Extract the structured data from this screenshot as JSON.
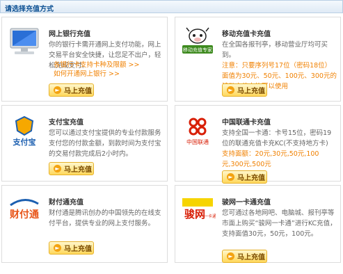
{
  "header": {
    "title": "请选择充值方式"
  },
  "cards": [
    {
      "title": "网上银行充值",
      "desc": "你的银行卡需开通网上支付功能，网上交易平台安全快捷，让您足不出户，轻松完成支付。",
      "links": [
        "各银行卡支持卡种及限额 >>",
        "如何开通网上银行 >>"
      ],
      "button": "马上充值"
    },
    {
      "title": "移动充值卡充值",
      "desc": "在全国各报刊亭，移动营业厅均可买到。",
      "note": "注意：只要序列号17位（密码18位）面值为30元、50元、100元、300元的移动充值卡均可以使用",
      "button": "马上充值"
    },
    {
      "title": "支付宝充值",
      "desc": "您可以通过支付宝提供的专业付款服务支付您的付款金额，到款时间为支付宝的交易付款完成后2小时内。",
      "button": "马上充值"
    },
    {
      "title": "中国联通卡充值",
      "desc": "支持全国一卡通：卡号15位，密码19位的联通充值卡充KC(不支持地方卡)",
      "note": "支持面额：20元,30元,50元,100元,300元,500元",
      "button": "马上充值"
    },
    {
      "title": "财付通充值",
      "desc": "财付通是腾讯创办的中国领先的在线支付平台，提供专业的网上支付服务。",
      "button": "马上充值"
    },
    {
      "title": "骏网一卡通充值",
      "desc": "您可通过各地网吧、电脑城、报刊亭等市面上购买“骏网一卡通”进行KC充值，支持面值30元，50元，100元。",
      "button": "马上充值"
    }
  ],
  "logos": {
    "zhifubao": "支付宝",
    "unicom": "中国联通",
    "tenpay": "财付通",
    "junnet": "骏网",
    "junnet_small": "一卡通",
    "mobile": "移动充值专家"
  },
  "colors": {
    "accent": "#f08000",
    "header_text": "#0b4f92",
    "button_bg": "#ffd85c"
  },
  "icons": [
    "computer-icon",
    "cow-mascot-icon",
    "alipay-logo-icon",
    "china-unicom-logo-icon",
    "tenpay-logo-icon",
    "junnet-logo-icon",
    "arrow-right-icon"
  ]
}
